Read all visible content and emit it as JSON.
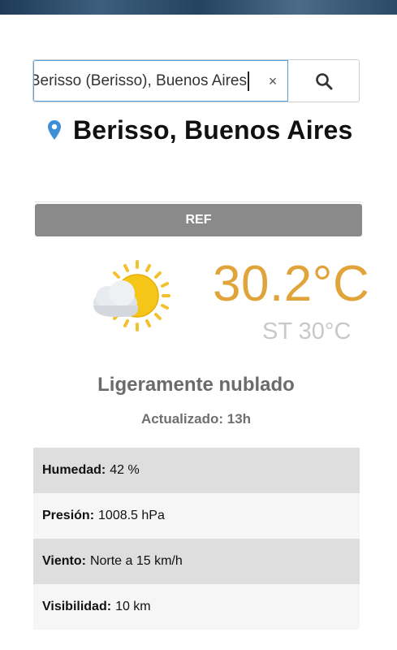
{
  "search": {
    "value": "Berisso (Berisso), Buenos Aires",
    "clear_label": "×"
  },
  "location": {
    "name": "Berisso, Buenos Aires"
  },
  "ref_bar": {
    "label": "REF"
  },
  "weather": {
    "icon": "partly-cloudy-sun-icon",
    "temperature": "30.2°C",
    "feels_like": "ST 30°C",
    "condition": "Ligeramente nublado",
    "updated": "Actualizado: 13h"
  },
  "details": [
    {
      "label": "Humedad:",
      "value": "42 %"
    },
    {
      "label": "Presión:",
      "value": "1008.5 hPa"
    },
    {
      "label": "Viento:",
      "value": "Norte a 15 km/h"
    },
    {
      "label": "Visibilidad:",
      "value": "10 km"
    }
  ],
  "colors": {
    "temperature": "#e0a43a",
    "pin": "#3b8fd6",
    "ref_bar": "#8a8a8a"
  }
}
